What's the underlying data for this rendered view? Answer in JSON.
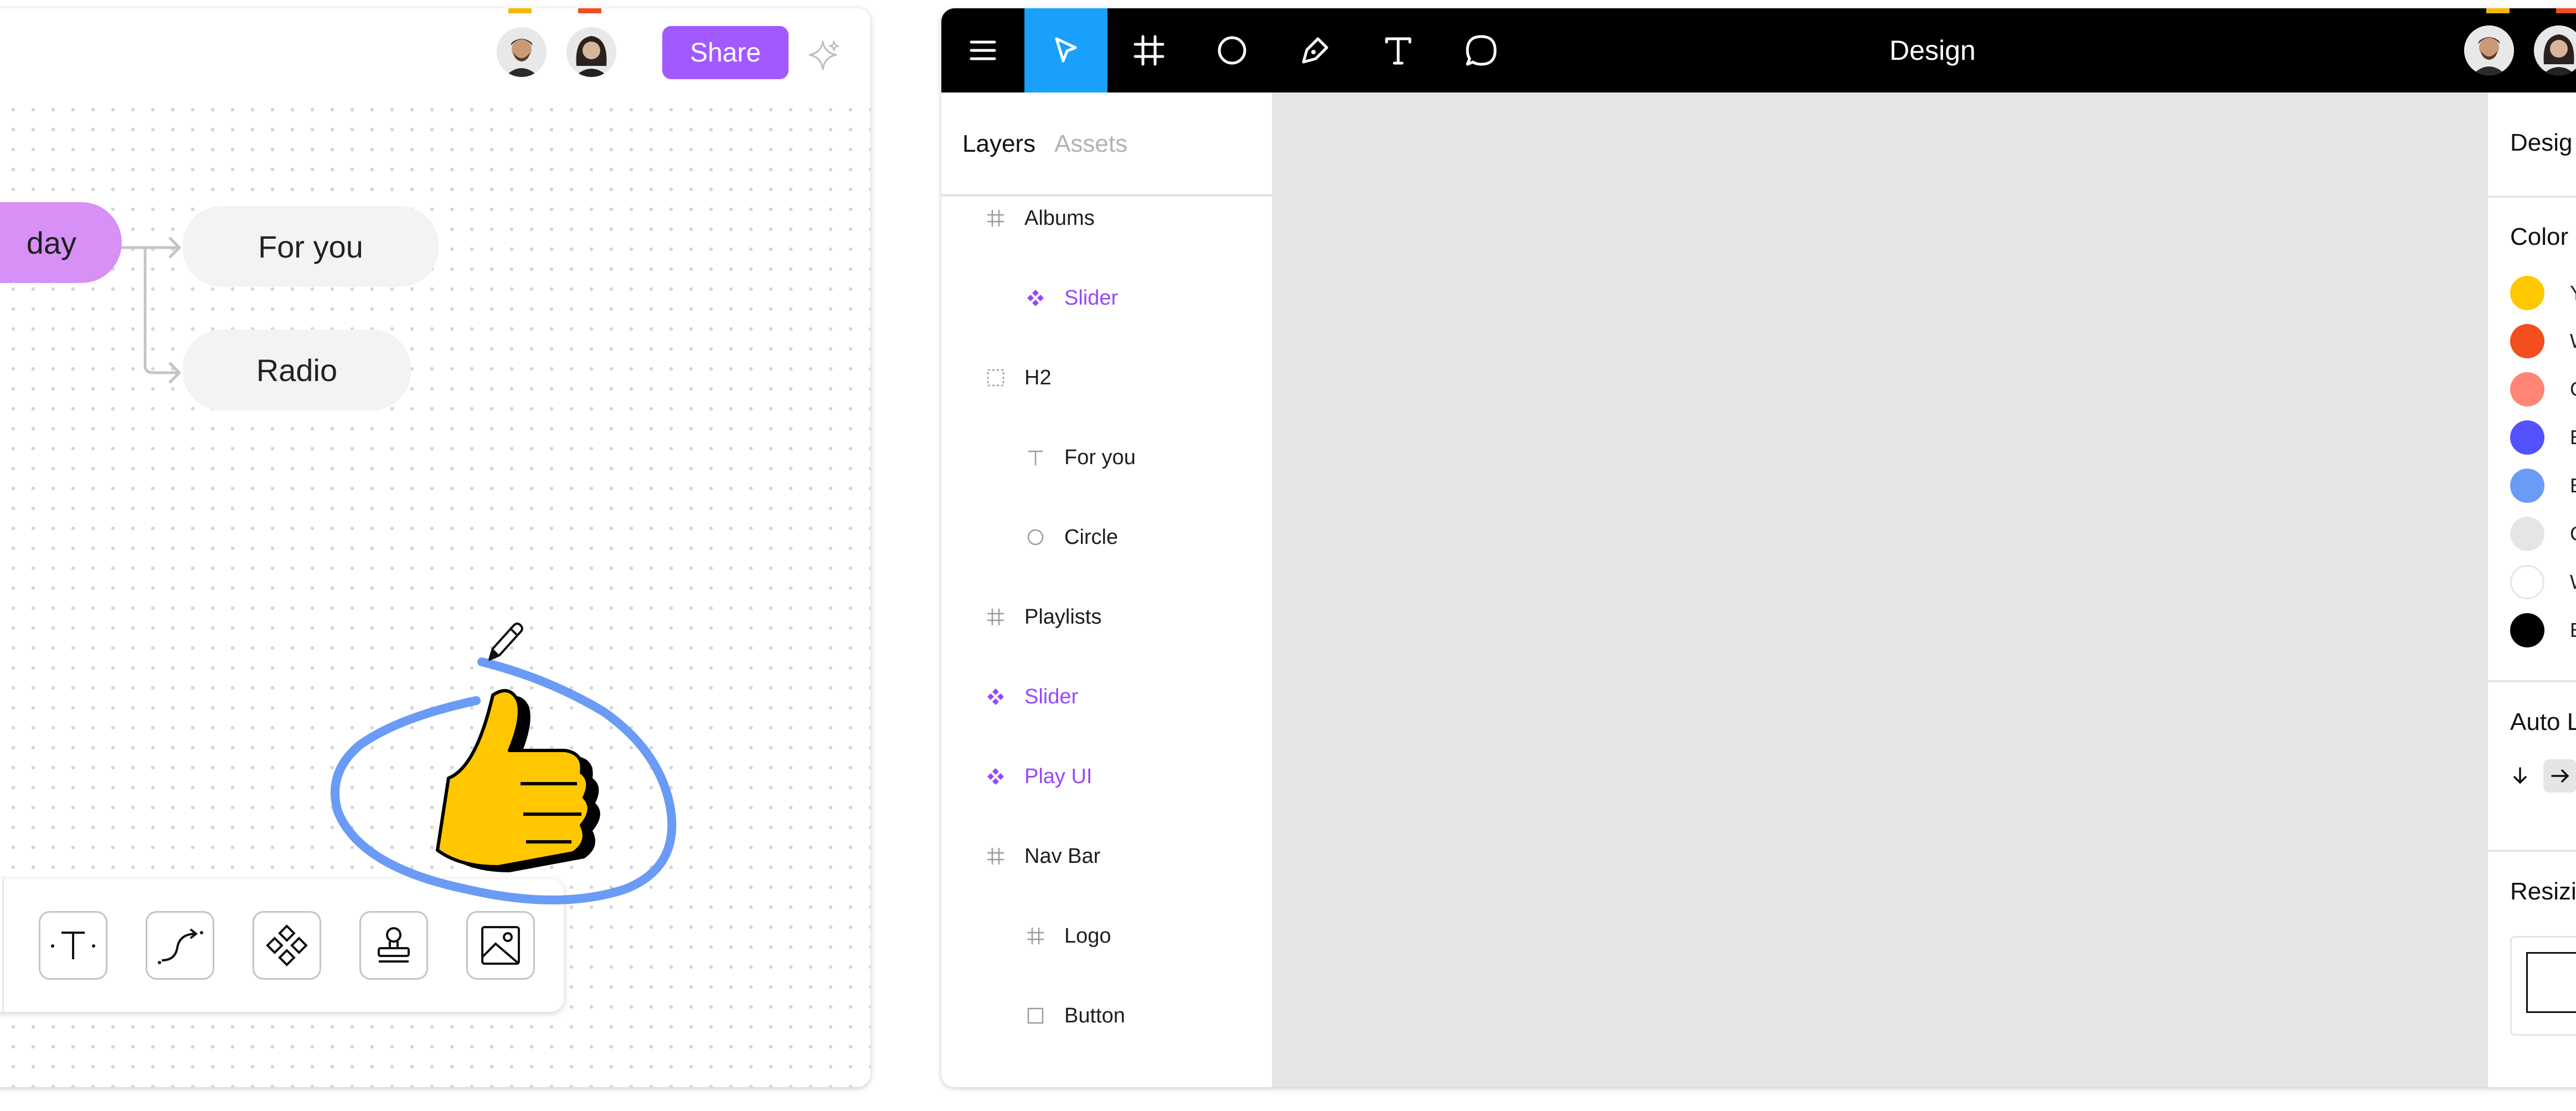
{
  "whiteboard": {
    "share_label": "Share",
    "nodes": {
      "today": "day",
      "for_you": "For you",
      "radio": "Radio"
    },
    "cursor_flags": {
      "left": "#f5b800",
      "right": "#f24e1e"
    },
    "accent": "#a259ff",
    "node_highlight": "#d790f5",
    "toolbar": {
      "tools": [
        "text-tool-icon",
        "connector-tool-icon",
        "component-tool-icon",
        "stamp-tool-icon",
        "image-tool-icon"
      ]
    },
    "sticker": "thumbs-up-icon",
    "ai_icon": "sparkle-icon"
  },
  "design": {
    "title": "Design",
    "toolbar_icons": [
      "menu-icon",
      "move-icon",
      "frame-icon",
      "ellipse-icon",
      "pen-icon",
      "text-icon",
      "comment-icon"
    ],
    "active_tool_color": "#18a0fb",
    "layers_panel": {
      "tabs": [
        "Layers",
        "Assets"
      ],
      "items": [
        {
          "label": "Albums",
          "icon": "frame-icon",
          "indent": 0,
          "component": false
        },
        {
          "label": "Slider",
          "icon": "component-icon",
          "indent": 1,
          "component": true
        },
        {
          "label": "H2",
          "icon": "group-icon",
          "indent": 0,
          "component": false
        },
        {
          "label": "For you",
          "icon": "text-icon",
          "indent": 1,
          "component": false
        },
        {
          "label": "Circle",
          "icon": "ellipse-icon",
          "indent": 1,
          "component": false
        },
        {
          "label": "Playlists",
          "icon": "frame-icon",
          "indent": 0,
          "component": false
        },
        {
          "label": "Slider",
          "icon": "component-icon",
          "indent": 0,
          "component": true
        },
        {
          "label": "Play UI",
          "icon": "component-icon",
          "indent": 0,
          "component": true
        },
        {
          "label": "Nav Bar",
          "icon": "frame-icon",
          "indent": 0,
          "component": false
        },
        {
          "label": "Logo",
          "icon": "frame-icon",
          "indent": 1,
          "component": false
        },
        {
          "label": "Button",
          "icon": "rectangle-icon",
          "indent": 1,
          "component": false
        }
      ]
    },
    "properties": {
      "heading": "Desig",
      "color_section": "Color",
      "colors": [
        {
          "letter": "Y",
          "hex": "#ffc700"
        },
        {
          "letter": "W",
          "hex": "#f24e1e"
        },
        {
          "letter": "C",
          "hex": "#ff8577"
        },
        {
          "letter": "E",
          "hex": "#5551ff"
        },
        {
          "letter": "E",
          "hex": "#699bf7"
        },
        {
          "letter": "C",
          "hex": "#e5e5e5"
        },
        {
          "letter": "W",
          "hex": "#ffffff"
        },
        {
          "letter": "E",
          "hex": "#000000"
        }
      ],
      "auto_layout_section": "Auto L",
      "auto_layout_down_icon": "arrow-down-icon",
      "auto_layout_right_icon": "arrow-right-icon",
      "resizing_section": "Resizi"
    }
  }
}
